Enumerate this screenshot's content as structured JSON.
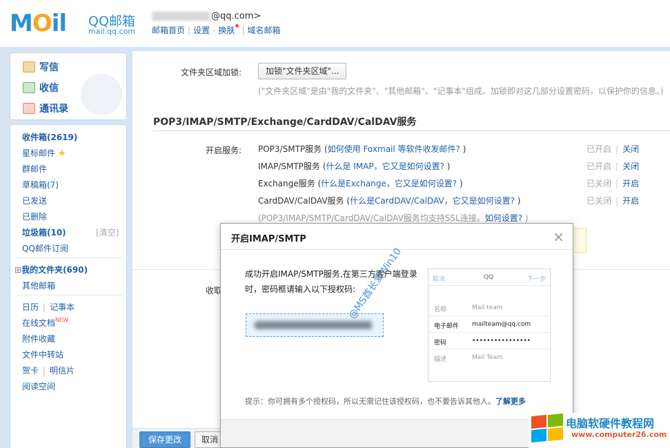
{
  "header": {
    "logo_text": "MOil",
    "logo_qq": "QQ邮箱",
    "logo_sub": "mail.qq.com",
    "email_suffix": "@qq.com>",
    "nav": [
      "邮箱首页",
      "设置",
      "换肤",
      "域名邮箱"
    ]
  },
  "sidebar": {
    "top": [
      {
        "label": "写信",
        "icon": "pen-icon"
      },
      {
        "label": "收信",
        "icon": "inbox-download-icon"
      },
      {
        "label": "通讯录",
        "icon": "contacts-icon"
      }
    ],
    "inbox": "收件箱(2619)",
    "starred": "星标邮件",
    "group": "群邮件",
    "drafts": "草稿箱(7)",
    "sent": "已发送",
    "deleted": "已删除",
    "junk": "垃圾箱(10)",
    "junk_clear": "[清空]",
    "subscribe": "QQ邮件订阅",
    "my_folders": "我的文件夹(690)",
    "other_mail": "其他邮箱",
    "calendar": "日历",
    "notepad": "记事本",
    "docs": "在线文档",
    "docs_badge": "NEW",
    "attachments": "附件收藏",
    "transfer": "文件中转站",
    "cards": "贺卡",
    "postcards": "明信片",
    "reading": "阅读空间"
  },
  "main": {
    "folder_lock_label": "文件夹区域加锁:",
    "folder_lock_button": "加锁\"文件夹区域\"...",
    "folder_lock_tip": "(\"文件夹区域\"是由\"我的文件夹\"、\"其他邮箱\"、\"记事本\"组成。加锁即对这几部分设置密码，以保护你的信息。)",
    "section_title": "POP3/IMAP/SMTP/Exchange/CardDAV/CalDAV服务",
    "enable_label": "开启服务:",
    "services": [
      {
        "name": "POP3/SMTP服务 (",
        "link": "如何使用 Foxmail 等软件收发邮件?",
        "tail": " )",
        "state": "已开启",
        "action": "关闭"
      },
      {
        "name": "IMAP/SMTP服务 (",
        "link": "什么是 IMAP，它又是如何设置?",
        "tail": " )",
        "state": "已开启",
        "action": "关闭"
      },
      {
        "name": "Exchange服务 (",
        "link": "什么是Exchange，它又是如何设置?",
        "tail": " )",
        "state": "已关闭",
        "action": "开启"
      },
      {
        "name": "CardDAV/CalDAV服务 (",
        "link": "什么是CardDAV/CalDAV，它又是如何设置?",
        "tail": " )",
        "state": "已关闭",
        "action": "开启"
      }
    ],
    "ssl_note": "(POP3/IMAP/SMTP/CardDAV/CalDAV服务均支持SSL连接。",
    "ssl_link": "如何设置?",
    "ssl_tail": " )",
    "receive_label": "收取",
    "save_button": "保存更改",
    "cancel_button": "取消"
  },
  "modal": {
    "title": "开启IMAP/SMTP",
    "close": "×",
    "message": "成功开启IMAP/SMTP服务,在第三方客户端登录时，密码框请输入以下授权码:",
    "watermark": "@MS酋长爱Win10",
    "phone": {
      "cancel": "取消",
      "title": "QQ",
      "next": "下一步",
      "rows": [
        {
          "key": "名称",
          "value": "Mail team",
          "dark": false
        },
        {
          "key": "电子邮件",
          "value": "mailteam@qq.com",
          "dark": true
        },
        {
          "key": "密码",
          "value": "••••••••••••••••",
          "dark": true
        },
        {
          "key": "描述",
          "value": "Mail Team",
          "dark": false
        }
      ]
    },
    "hint": "提示：你可拥有多个授权码，所以无需记住该授权码，也不要告诉其他人。",
    "hint_link": "了解更多"
  },
  "brand": {
    "title": "电脑软硬件教程网",
    "url": "www.computer26.com"
  },
  "colors": {
    "accent": "#1c5fa8",
    "frame": "#d6e4f3",
    "primary_button": "#4f94d5"
  }
}
